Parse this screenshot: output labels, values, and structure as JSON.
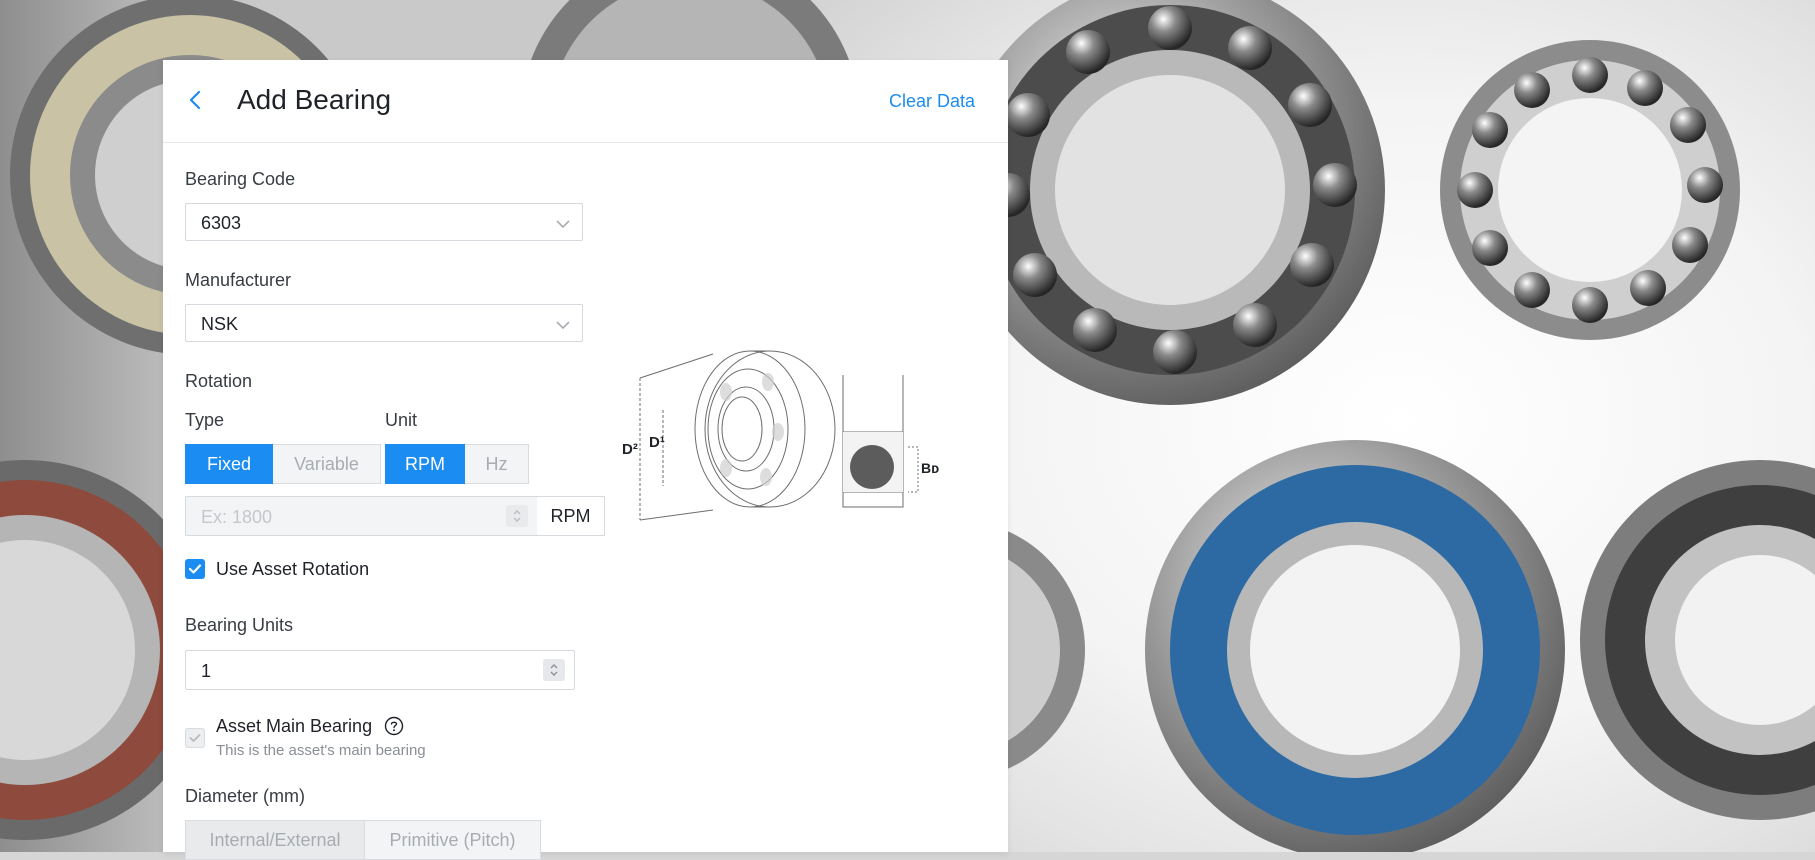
{
  "header": {
    "title": "Add Bearing",
    "clear_label": "Clear Data"
  },
  "form": {
    "bearing_code": {
      "label": "Bearing Code",
      "value": "6303"
    },
    "manufacturer": {
      "label": "Manufacturer",
      "value": "NSK"
    },
    "rotation": {
      "label": "Rotation",
      "type_label": "Type",
      "unit_label": "Unit",
      "type_options": [
        "Fixed",
        "Variable"
      ],
      "type_selected": "Fixed",
      "unit_options": [
        "RPM",
        "Hz"
      ],
      "unit_selected": "RPM",
      "speed_placeholder": "Ex: 1800",
      "speed_unit": "RPM",
      "use_asset_rotation_label": "Use Asset Rotation",
      "use_asset_rotation_checked": true
    },
    "bearing_units": {
      "label": "Bearing Units",
      "value": "1"
    },
    "asset_main_bearing": {
      "label": "Asset Main Bearing",
      "help": "This is the asset's main bearing",
      "checked": true,
      "disabled": true
    },
    "diameter": {
      "label": "Diameter (mm)",
      "options": [
        "Internal/External",
        "Primitive (Pitch)"
      ]
    }
  },
  "diagram": {
    "labels": {
      "outer": "D²",
      "inner": "D¹",
      "ball": "Bᴅ"
    }
  },
  "colors": {
    "accent": "#1a8cf2",
    "text": "#1f2329",
    "bearing_seal_blue": "#2d6aa3"
  }
}
